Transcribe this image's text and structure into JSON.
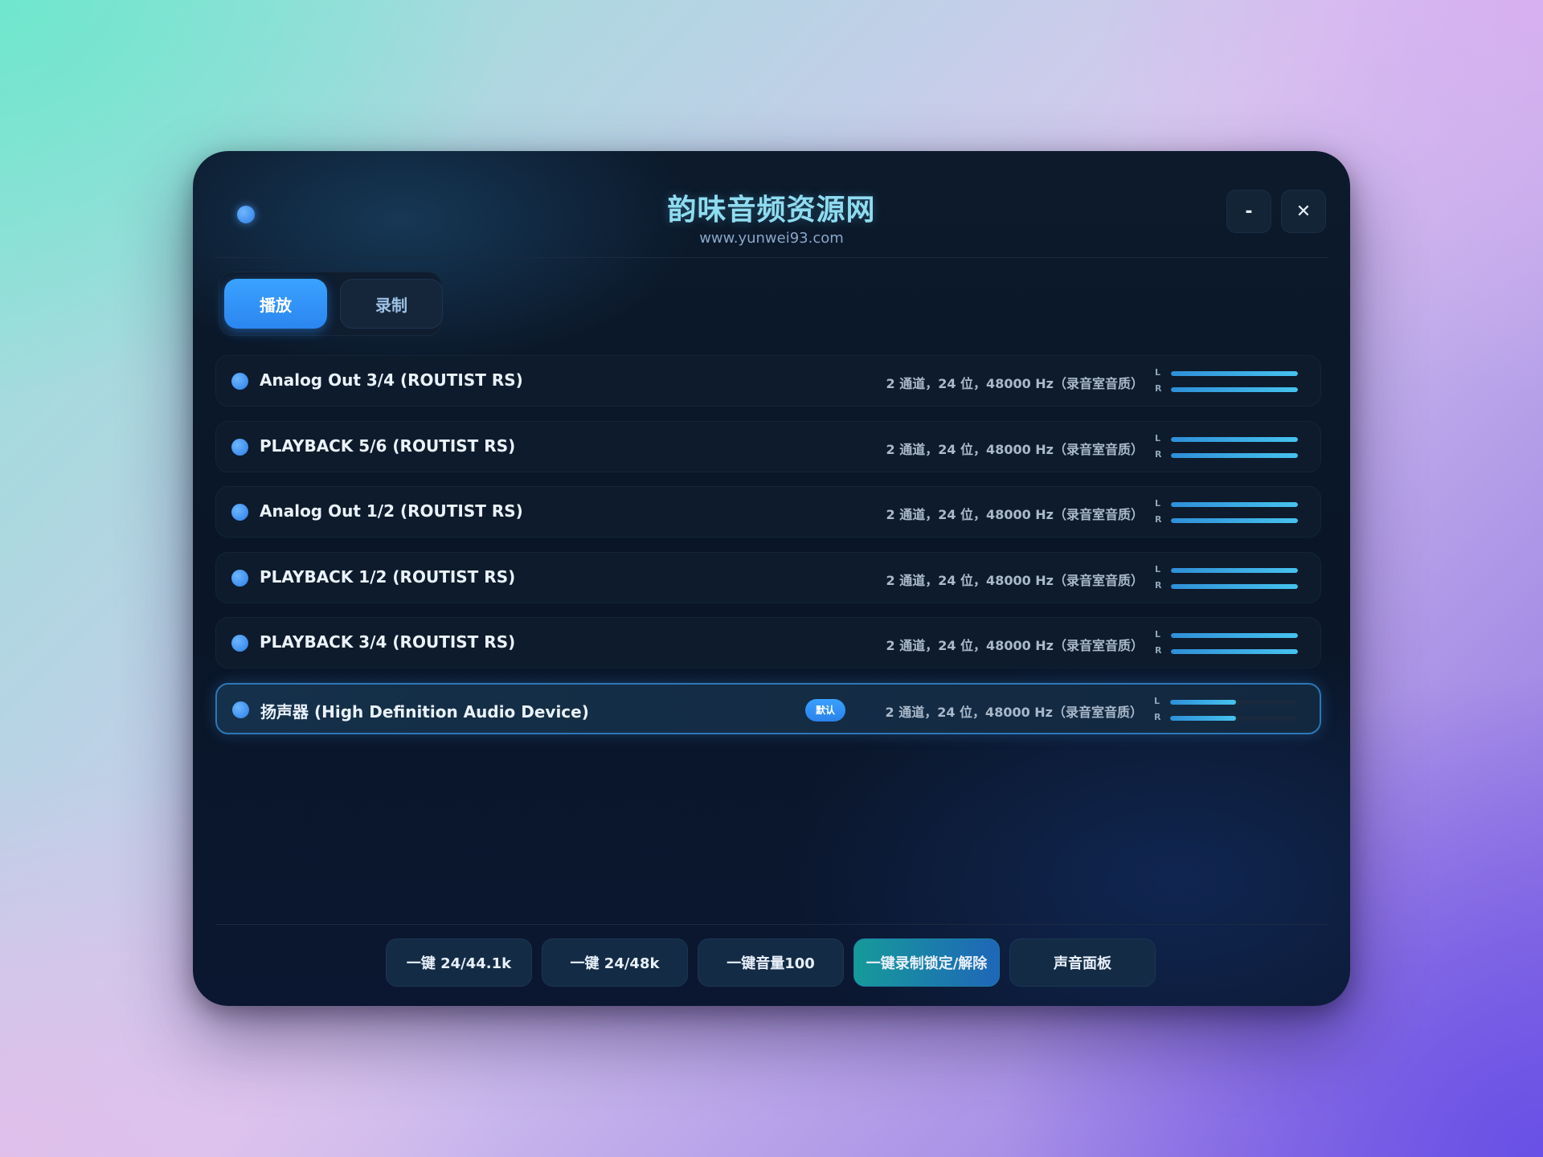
{
  "window": {
    "title": "韵味音频资源网",
    "url": "www.yunwei93.com",
    "minimize_label": "-",
    "close_label": "✕"
  },
  "tabs": [
    {
      "label": "播放",
      "active": true
    },
    {
      "label": "录制",
      "active": false
    }
  ],
  "devices": [
    {
      "name": "Analog Out 3/4 (ROUTIST RS)",
      "format": "2 通道，24 位，48000 Hz（录音室音质）",
      "level_l": 1.0,
      "level_r": 1.0
    },
    {
      "name": "PLAYBACK 5/6 (ROUTIST RS)",
      "format": "2 通道，24 位，48000 Hz（录音室音质）",
      "level_l": 1.0,
      "level_r": 1.0
    },
    {
      "name": "Analog Out 1/2 (ROUTIST RS)",
      "format": "2 通道，24 位，48000 Hz（录音室音质）",
      "level_l": 1.0,
      "level_r": 1.0
    },
    {
      "name": "PLAYBACK 1/2 (ROUTIST RS)",
      "format": "2 通道，24 位，48000 Hz（录音室音质）",
      "level_l": 1.0,
      "level_r": 1.0
    },
    {
      "name": "PLAYBACK 3/4 (ROUTIST RS)",
      "format": "2 通道，24 位，48000 Hz（录音室音质）",
      "level_l": 1.0,
      "level_r": 1.0
    },
    {
      "name": "扬声器 (High Definition Audio Device)",
      "format": "2 通道，24 位，48000 Hz（录音室音质）",
      "level_l": 0.52,
      "level_r": 0.52,
      "badge": "默认",
      "selected": true
    }
  ],
  "meter_labels": {
    "left": "L",
    "right": "R"
  },
  "actions": [
    {
      "label": "一键 24/44.1k"
    },
    {
      "label": "一键 24/48k"
    },
    {
      "label": "一键音量100"
    },
    {
      "label": "一键录制锁定/解除",
      "highlight": true
    },
    {
      "label": "声音面板"
    }
  ],
  "colors": {
    "accent": "#2b86f0",
    "meter": "#46c3ee",
    "title": "#8fdcf0"
  }
}
